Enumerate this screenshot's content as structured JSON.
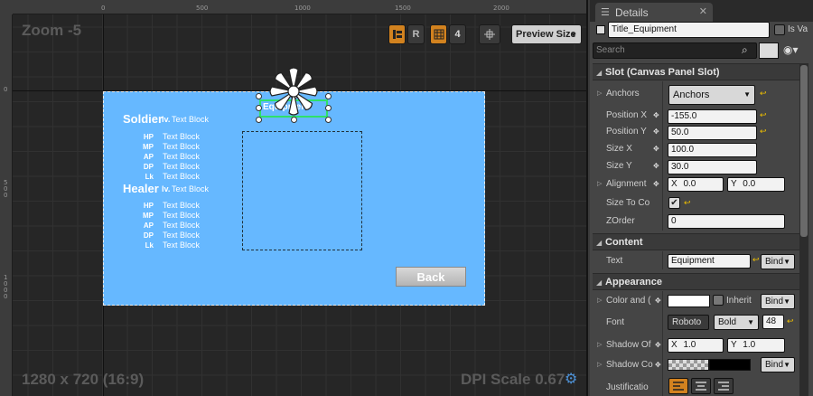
{
  "designer": {
    "zoom": "Zoom -5",
    "resolution": "1280 x 720 (16:9)",
    "dpi_scale": "DPI Scale 0.67",
    "toolbar": {
      "r_label": "R",
      "grid_snap": "4",
      "preview_size": "Preview Size"
    },
    "ruler_top": [
      "0",
      "500",
      "1000",
      "1500",
      "2000"
    ],
    "ruler_left": [
      "0",
      "5\n0\n0",
      "1\n0\n0\n0"
    ],
    "canvas": {
      "soldier_title": "Soldier",
      "soldier_lv": "lv.",
      "soldier_lv_value": "Text Block",
      "healer_title": "Healer",
      "healer_lv": "lv.",
      "healer_lv_value": "Text Block",
      "stats": [
        "HP",
        "MP",
        "AP",
        "DP",
        "Lk"
      ],
      "stat_value": "Text Block",
      "selected_text": "Equipment",
      "back_button": "Back"
    }
  },
  "details": {
    "tab_title": "Details",
    "widget_name": "Title_Equipment",
    "is_variable_label": "Is Va",
    "search_placeholder": "Search",
    "slot_section": "Slot (Canvas Panel Slot)",
    "anchors_label": "Anchors",
    "anchors_value": "Anchors",
    "position_x_label": "Position X",
    "position_x": "-155.0",
    "position_y_label": "Position Y",
    "position_y": "50.0",
    "size_x_label": "Size X",
    "size_x": "100.0",
    "size_y_label": "Size Y",
    "size_y": "30.0",
    "alignment_label": "Alignment",
    "align_x_label": "X",
    "align_x": "0.0",
    "align_y_label": "Y",
    "align_y": "0.0",
    "size_to_content_label": "Size To Co",
    "zorder_label": "ZOrder",
    "zorder": "0",
    "content_section": "Content",
    "text_label": "Text",
    "text_value": "Equipment",
    "bind_label": "Bind",
    "appearance_section": "Appearance",
    "color_label": "Color and (",
    "inherit_label": "Inherit",
    "font_label": "Font",
    "font_family": "Roboto",
    "font_style": "Bold",
    "font_size": "48",
    "shadow_offset_label": "Shadow Of",
    "shadow_x_label": "X",
    "shadow_x": "1.0",
    "shadow_y_label": "Y",
    "shadow_y": "1.0",
    "shadow_color_label": "Shadow Co",
    "justification_label": "Justificatio"
  }
}
